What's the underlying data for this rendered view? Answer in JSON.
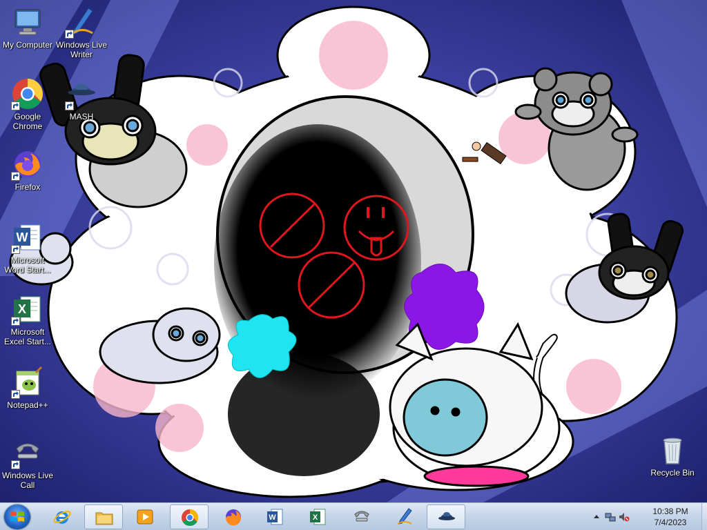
{
  "desktop": {
    "icons": [
      {
        "id": "my-computer",
        "label": "My Computer",
        "shortcut": false
      },
      {
        "id": "windows-live-writer",
        "label": "Windows Live Writer",
        "shortcut": true
      },
      {
        "id": "google-chrome",
        "label": "Google Chrome",
        "shortcut": true
      },
      {
        "id": "mash",
        "label": "MASH",
        "shortcut": true
      },
      {
        "id": "firefox",
        "label": "Firefox",
        "shortcut": true
      },
      {
        "id": "microsoft-word-starter",
        "label": "Microsoft Word Start...",
        "shortcut": true
      },
      {
        "id": "microsoft-excel-starter",
        "label": "Microsoft Excel Start...",
        "shortcut": true
      },
      {
        "id": "notepad-plus-plus",
        "label": "Notepad++",
        "shortcut": true
      },
      {
        "id": "windows-live-call",
        "label": "Windows Live Call",
        "shortcut": true
      },
      {
        "id": "recycle-bin",
        "label": "Recycle Bin",
        "shortcut": false
      }
    ]
  },
  "taskbar": {
    "start": {
      "icon": "windows-logo-icon"
    },
    "pinned": [
      {
        "id": "internet-explorer",
        "icon": "internet-explorer-icon"
      },
      {
        "id": "file-explorer",
        "icon": "folder-icon",
        "active": true
      },
      {
        "id": "media-player",
        "icon": "media-player-icon"
      },
      {
        "id": "chrome",
        "icon": "chrome-icon",
        "active": true
      },
      {
        "id": "firefox",
        "icon": "firefox-icon"
      },
      {
        "id": "word",
        "icon": "word-icon"
      },
      {
        "id": "excel",
        "icon": "excel-icon"
      },
      {
        "id": "live-call",
        "icon": "phone-icon"
      },
      {
        "id": "live-writer",
        "icon": "pen-icon"
      },
      {
        "id": "mash",
        "icon": "mash-hat-icon",
        "active": true
      }
    ],
    "tray": {
      "icons": [
        "show-hidden-icons-arrow-icon",
        "network-icon",
        "volume-muted-icon"
      ],
      "time": "10:38 PM",
      "date": "7/4/2023"
    }
  }
}
